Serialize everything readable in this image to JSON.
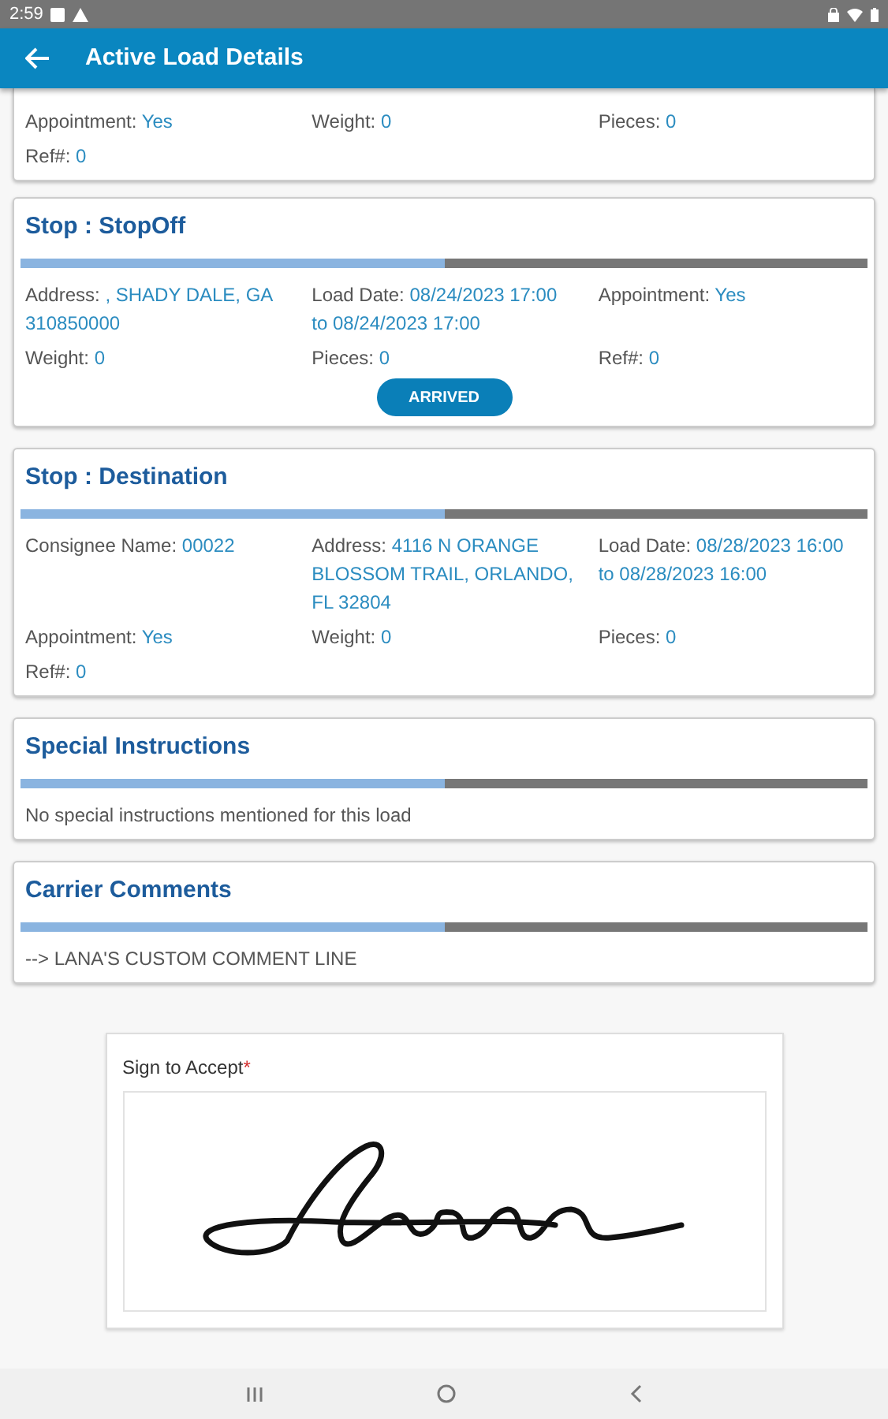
{
  "status_bar": {
    "time": "2:59"
  },
  "app_bar": {
    "title": "Active Load Details"
  },
  "partial_card": {
    "fields": [
      {
        "label": "Appointment:",
        "value": "Yes"
      },
      {
        "label": "Weight:",
        "value": "0"
      },
      {
        "label": "Pieces:",
        "value": "0"
      },
      {
        "label": "Ref#:",
        "value": "0"
      }
    ]
  },
  "cards": [
    {
      "kind": "stop",
      "title": "Stop : StopOff",
      "fields": [
        {
          "label": "Address:",
          "value": ", SHADY DALE, GA 310850000"
        },
        {
          "label": "Load Date:",
          "value": "08/24/2023 17:00 to 08/24/2023 17:00"
        },
        {
          "label": "Appointment:",
          "value": "Yes"
        },
        {
          "label": "Weight:",
          "value": "0"
        },
        {
          "label": "Pieces:",
          "value": "0"
        },
        {
          "label": "Ref#:",
          "value": "0"
        }
      ],
      "button": "ARRIVED"
    },
    {
      "kind": "stop",
      "title": "Stop : Destination",
      "fields": [
        {
          "label": "Consignee Name:",
          "value": "00022"
        },
        {
          "label": "Address:",
          "value": "4116 N ORANGE BLOSSOM TRAIL, ORLANDO, FL 32804"
        },
        {
          "label": "Load Date:",
          "value": "08/28/2023 16:00 to 08/28/2023 16:00"
        },
        {
          "label": "Appointment:",
          "value": "Yes"
        },
        {
          "label": "Weight:",
          "value": "0"
        },
        {
          "label": "Pieces:",
          "value": "0"
        },
        {
          "label": "Ref#:",
          "value": "0"
        }
      ]
    },
    {
      "kind": "note",
      "title": "Special Instructions",
      "text": "No special instructions mentioned for this load"
    },
    {
      "kind": "note",
      "title": "Carrier Comments",
      "text": "--> LANA'S CUSTOM COMMENT LINE"
    }
  ],
  "signature": {
    "label": "Sign to Accept",
    "required_mark": "*"
  }
}
